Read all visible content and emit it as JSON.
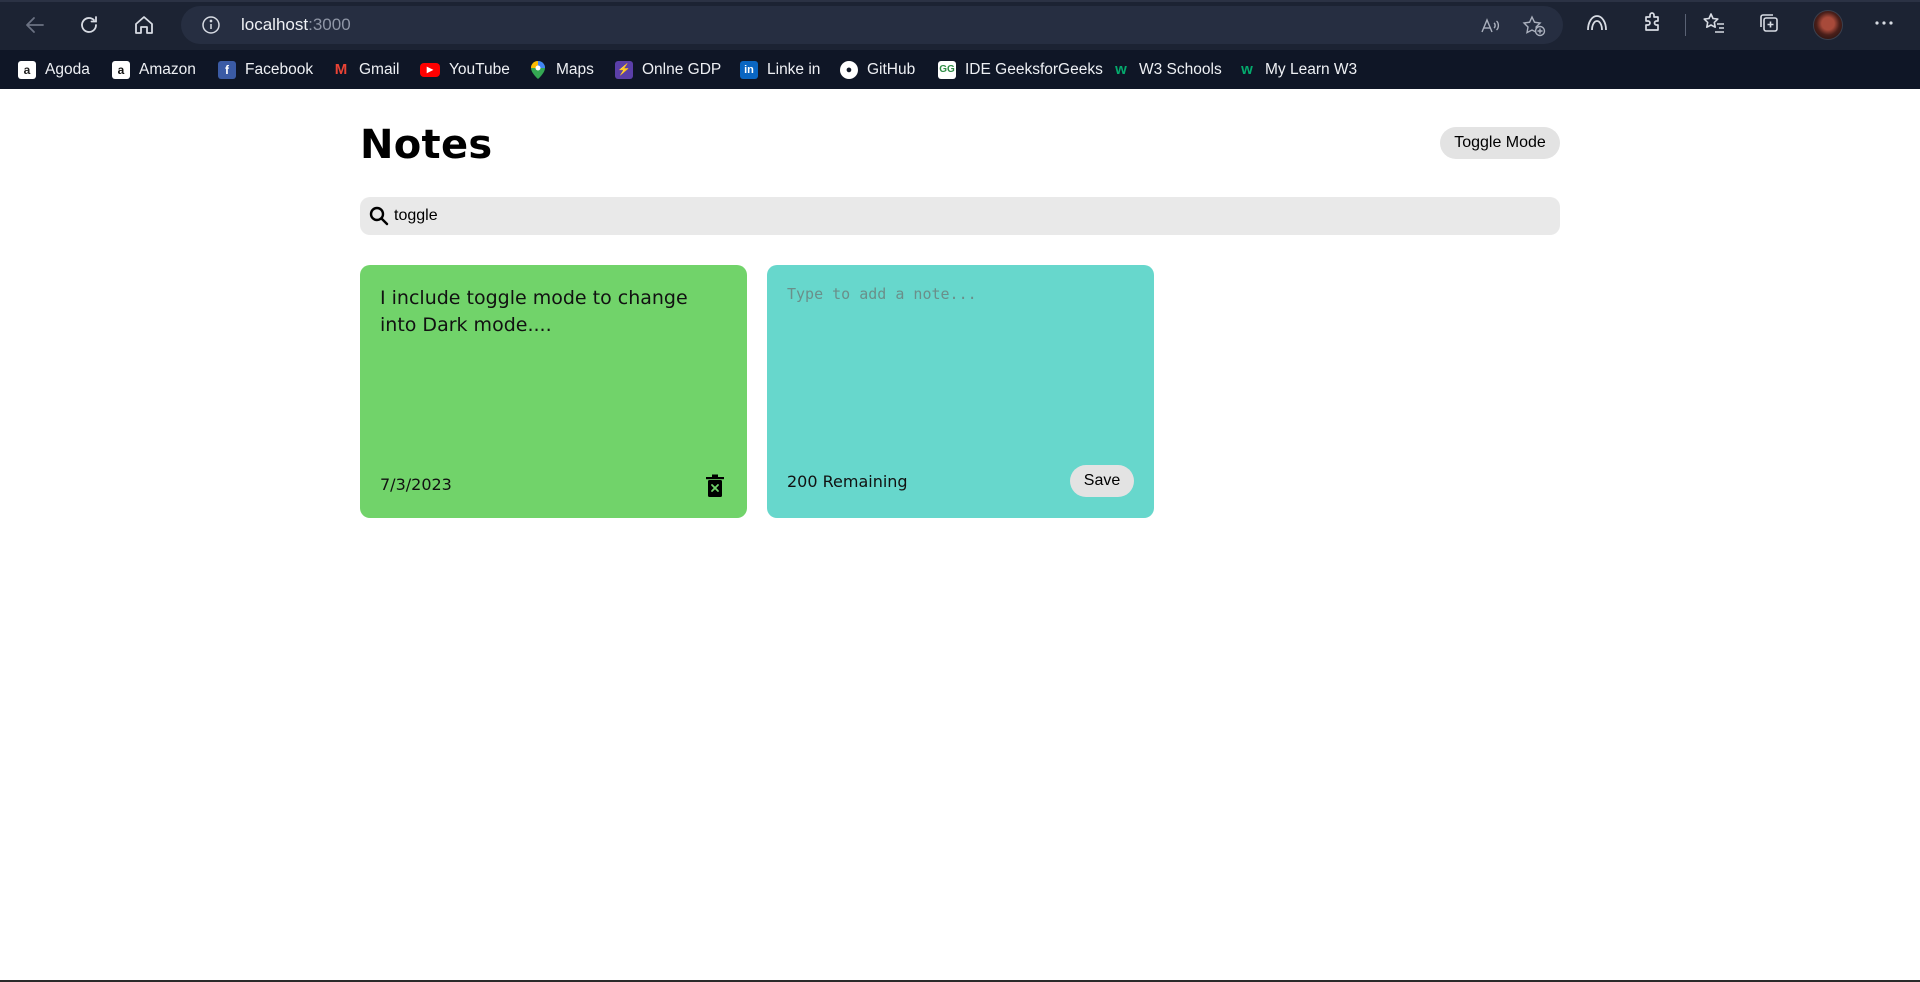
{
  "browser": {
    "url_host": "localhost",
    "url_port": ":3000",
    "icons": {
      "back": "back-arrow-icon",
      "reload": "reload-icon",
      "home": "home-icon",
      "site_info": "info-icon",
      "read_aloud": "read-aloud-icon",
      "add_favorite": "star-add-icon",
      "browser_essentials": "browser-essentials-icon",
      "extensions": "puzzle-icon",
      "favorites": "favorites-icon",
      "collections": "collections-icon",
      "profile": "avatar",
      "more": "more-icon"
    },
    "bookmarks": [
      {
        "label": "Agoda",
        "icon": "agoda-icon",
        "color": "#ffffff"
      },
      {
        "label": "Amazon",
        "icon": "amazon-icon",
        "color": "#ffffff"
      },
      {
        "label": "Facebook",
        "icon": "facebook-icon",
        "color": "#3b5ba5"
      },
      {
        "label": "Gmail",
        "icon": "gmail-icon",
        "color": "#ea4335"
      },
      {
        "label": "YouTube",
        "icon": "youtube-icon",
        "color": "#ff0000"
      },
      {
        "label": "Maps",
        "icon": "maps-icon",
        "color": "#34a853"
      },
      {
        "label": "Onlne GDP",
        "icon": "online-gdp-icon",
        "color": "#5b3fa8"
      },
      {
        "label": "Linke in",
        "icon": "linkedin-icon",
        "color": "#0a66c2"
      },
      {
        "label": "GitHub",
        "icon": "github-icon",
        "color": "#ffffff"
      },
      {
        "label": "IDE GeeksforGeeks",
        "icon": "geeksforgeeks-icon",
        "color": "#2f8d46"
      },
      {
        "label": "W3 Schools",
        "icon": "w3schools-icon",
        "color": "#04aa6d"
      },
      {
        "label": "My Learn W3",
        "icon": "w3schools-icon",
        "color": "#04aa6d"
      }
    ]
  },
  "app": {
    "title": "Notes",
    "toggle_label": "Toggle Mode",
    "search": {
      "value": "toggle",
      "icon": "search-icon"
    },
    "notes": [
      {
        "text": "I include toggle mode to change into Dark mode....",
        "date": "7/3/2023",
        "color": "#71d36a",
        "delete_icon": "trash-icon"
      }
    ],
    "new_note": {
      "placeholder": "Type to add a note...",
      "remaining_label": "200 Remaining",
      "save_label": "Save",
      "color": "#67d7cc"
    }
  }
}
